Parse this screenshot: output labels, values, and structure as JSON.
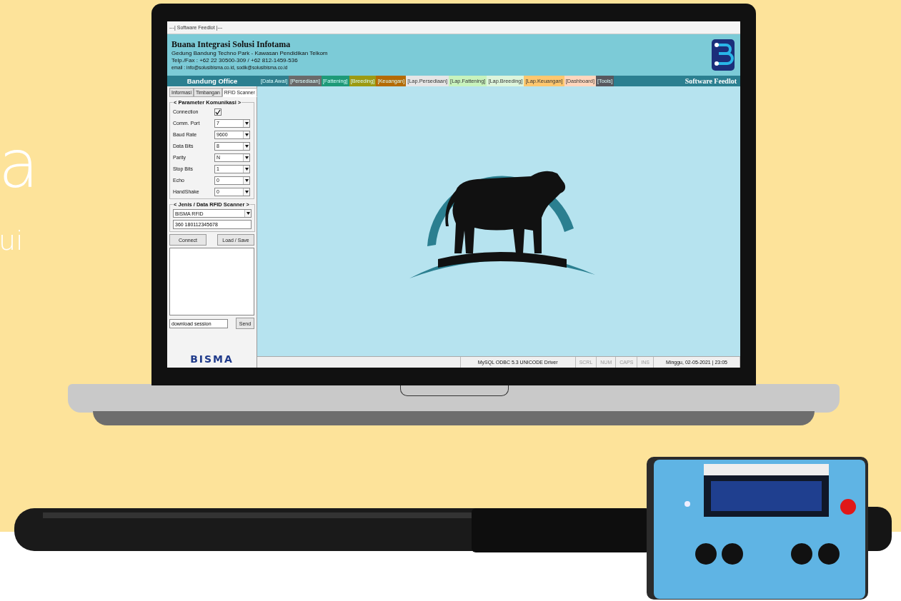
{
  "backdrop_texts": [
    "a",
    "ui"
  ],
  "window": {
    "title": "---| Software Feedlot |---"
  },
  "header": {
    "company": "Buana Integrasi Solusi Infotama",
    "lines": [
      "Gedung Bandung Techno Park - Kawasan Pendidikan Telkom",
      "Telp./Fax : +62 22 30500-309 / +62 812-1459-536",
      "email : info@solusibisma.co.id, sodik@solusibisma.co.id"
    ]
  },
  "office": "Bandung Office",
  "menu": [
    {
      "label": "[Data Awal]",
      "color": "#2f7f8e"
    },
    {
      "label": "[Persediaan]",
      "color": "#6a6a6a"
    },
    {
      "label": "[Fattening]",
      "color": "#1e9a78"
    },
    {
      "label": "[Breeding]",
      "color": "#9c9a12"
    },
    {
      "label": "[Keuangan]",
      "color": "#b46b05"
    },
    {
      "label": "[Lap.Persediaan]",
      "color": "#e6e6e6"
    },
    {
      "label": "[Lap.Fattening]",
      "color": "#c8f3bd"
    },
    {
      "label": "[Lap.Breeding]",
      "color": "#ddf5dc"
    },
    {
      "label": "[Lap.Keuangan]",
      "color": "#ffc76e"
    },
    {
      "label": "[Dashboard]",
      "color": "#ffd6bd"
    },
    {
      "label": "[Tools]",
      "color": "#58585e"
    }
  ],
  "app_name": "Software Feedlot",
  "side_tabs": [
    {
      "label": "Informasi",
      "selected": false
    },
    {
      "label": "Timbangan",
      "selected": false
    },
    {
      "label": "RFID Scanner",
      "selected": true
    }
  ],
  "parameters": {
    "title": "< Parameter Komunikasi >",
    "rows": [
      {
        "kind": "checkbox",
        "label": "Connection",
        "checked": true
      },
      {
        "kind": "combo",
        "label": "Comm. Port",
        "value": "7"
      },
      {
        "kind": "combo",
        "label": "Baud Rate",
        "value": "9600"
      },
      {
        "kind": "combo",
        "label": "Data Bits",
        "value": "8"
      },
      {
        "kind": "combo",
        "label": "Parity",
        "value": "N"
      },
      {
        "kind": "combo",
        "label": "Stop Bits",
        "value": "1"
      },
      {
        "kind": "combo",
        "label": "Echo",
        "value": "0"
      },
      {
        "kind": "combo",
        "label": "HandShake",
        "value": "0"
      }
    ]
  },
  "scanner": {
    "title": "< Jenis / Data RFID Scanner >",
    "type": "BISMA RFID",
    "data": "360 180112345678"
  },
  "buttons": [
    "Connect",
    "Load / Save"
  ],
  "command": {
    "value": "download session",
    "button": "Send"
  },
  "brand": "BISMA",
  "status_bar": [
    {
      "text": "MySQL ODBC 5.3 UNICODE Driver",
      "disabled": false
    },
    {
      "text": "SCRL",
      "disabled": true
    },
    {
      "text": "NUM",
      "disabled": true
    },
    {
      "text": "CAPS",
      "disabled": true
    },
    {
      "text": "INS",
      "disabled": true
    },
    {
      "text": "Minggu, 02-05-2021 | 23:05",
      "disabled": false
    }
  ]
}
